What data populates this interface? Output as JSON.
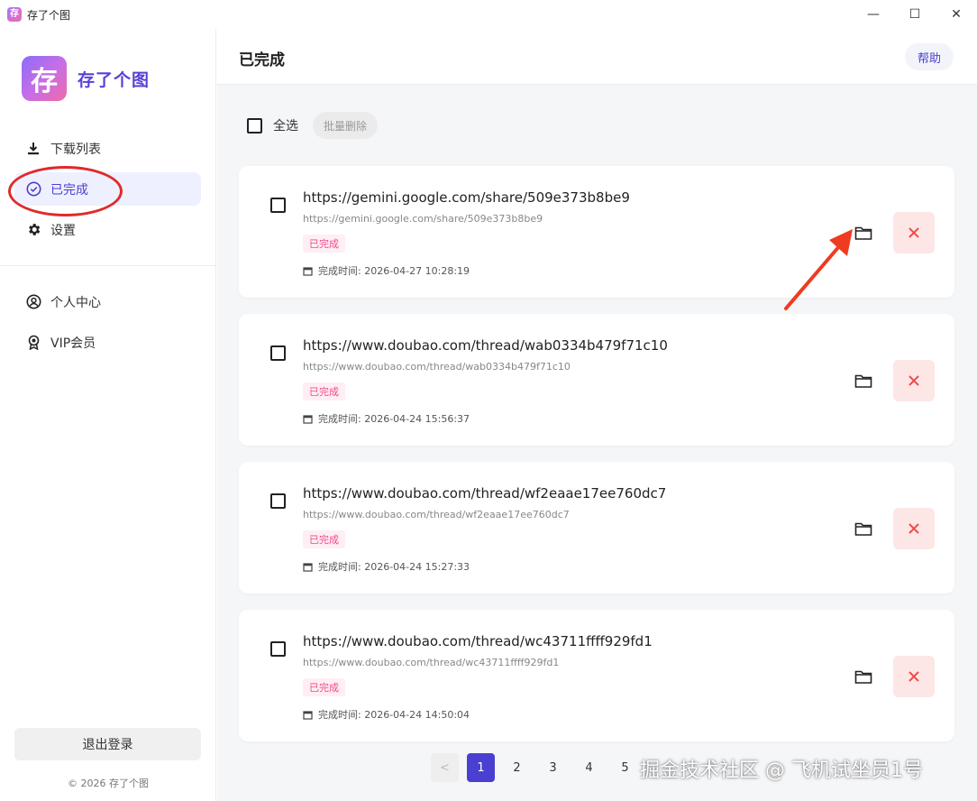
{
  "window": {
    "title": "存了个图",
    "app_icon_glyph": "存",
    "controls": {
      "minimize": "—",
      "maximize": "☐",
      "close": "✕"
    }
  },
  "sidebar": {
    "brand": {
      "logo_glyph": "存",
      "name": "存了个图"
    },
    "nav": [
      {
        "label": "下载列表",
        "icon": "download-icon"
      },
      {
        "label": "已完成",
        "icon": "check-circle-icon",
        "active": true
      },
      {
        "label": "设置",
        "icon": "gear-icon"
      }
    ],
    "nav2": [
      {
        "label": "个人中心",
        "icon": "user-circle-icon"
      },
      {
        "label": "VIP会员",
        "icon": "award-icon"
      }
    ],
    "logout": "退出登录",
    "copyright": "© 2026 存了个图"
  },
  "header": {
    "title": "已完成",
    "help": "帮助"
  },
  "toolbar": {
    "select_all": "全选",
    "batch_delete": "批量删除"
  },
  "items": [
    {
      "title": "https://gemini.google.com/share/509e373b8be9",
      "url": "https://gemini.google.com/share/509e373b8be9",
      "status": "已完成",
      "time": "完成时间: 2026-04-27 10:28:19"
    },
    {
      "title": "https://www.doubao.com/thread/wab0334b479f71c10",
      "url": "https://www.doubao.com/thread/wab0334b479f71c10",
      "status": "已完成",
      "time": "完成时间: 2026-04-24 15:56:37"
    },
    {
      "title": "https://www.doubao.com/thread/wf2eaae17ee760dc7",
      "url": "https://www.doubao.com/thread/wf2eaae17ee760dc7",
      "status": "已完成",
      "time": "完成时间: 2026-04-24 15:27:33"
    },
    {
      "title": "https://www.doubao.com/thread/wc43711ffff929fd1",
      "url": "https://www.doubao.com/thread/wc43711ffff929fd1",
      "status": "已完成",
      "time": "完成时间: 2026-04-24 14:50:04"
    }
  ],
  "pagination": {
    "prev": "<",
    "pages": [
      "1",
      "2",
      "3",
      "4",
      "5"
    ],
    "current": "1"
  },
  "watermark": "掘金技术社区 @ 飞机试坐员1号",
  "colors": {
    "accent": "#4a3fd1",
    "status_pink": "#ee4b8a",
    "delete_red": "#ef4a4a",
    "annotation_red": "#e02a2a"
  }
}
